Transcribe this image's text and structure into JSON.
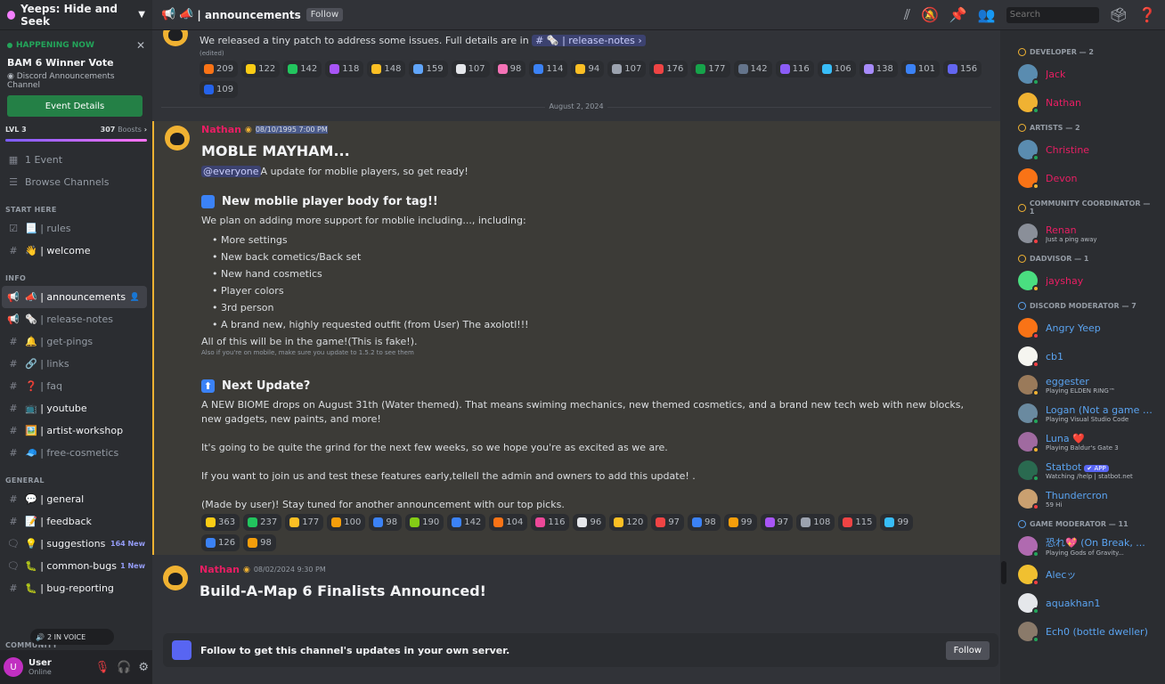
{
  "server": {
    "name": "Yeeps: Hide and Seek"
  },
  "event": {
    "happening": "HAPPENING NOW",
    "title": "BAM 6 Winner Vote",
    "location": "Discord Announcements Channel",
    "button": "Event Details"
  },
  "boost": {
    "level": "LVL 3",
    "count": "307",
    "label": "Boosts"
  },
  "sidebar_top": [
    {
      "icon": "calendar-icon",
      "label": "1 Event"
    },
    {
      "icon": "browse-icon",
      "label": "Browse Channels"
    }
  ],
  "categories": [
    {
      "name": "START HERE",
      "channels": [
        {
          "prefix": "☑",
          "label": "📃 | rules",
          "active": false,
          "badge": ""
        },
        {
          "prefix": "#",
          "label": "👋 | welcome",
          "active": false,
          "badge": "",
          "bright": true
        }
      ]
    },
    {
      "name": "INFO",
      "channels": [
        {
          "prefix": "📢",
          "label": "📣 | announcements",
          "active": true,
          "badge": ""
        },
        {
          "prefix": "📢",
          "label": "🗞️ | release-notes",
          "active": false,
          "badge": ""
        },
        {
          "prefix": "#",
          "label": "🔔 | get-pings",
          "active": false,
          "badge": ""
        },
        {
          "prefix": "#",
          "label": "🔗 | links",
          "active": false,
          "badge": ""
        },
        {
          "prefix": "#",
          "label": "❓ | faq",
          "active": false,
          "badge": ""
        },
        {
          "prefix": "#",
          "label": "📺 | youtube",
          "active": false,
          "badge": "",
          "bright": true
        },
        {
          "prefix": "#",
          "label": "🖼️ | artist-workshop",
          "active": false,
          "badge": "",
          "bright": true
        },
        {
          "prefix": "#",
          "label": "🧢 | free-cosmetics",
          "active": false,
          "badge": ""
        }
      ]
    },
    {
      "name": "GENERAL",
      "channels": [
        {
          "prefix": "#",
          "label": "💬 | general",
          "active": false,
          "badge": "",
          "bright": true
        },
        {
          "prefix": "#",
          "label": "📝 | feedback",
          "active": false,
          "badge": "",
          "bright": true
        },
        {
          "prefix": "🗨",
          "label": "💡 | suggestions",
          "active": false,
          "badge": "164 New",
          "bright": true
        },
        {
          "prefix": "🗨",
          "label": "🐛 | common-bugs",
          "active": false,
          "badge": "1 New",
          "bright": true
        },
        {
          "prefix": "#",
          "label": "🐛 | bug-reporting",
          "active": false,
          "badge": "",
          "bright": true
        }
      ]
    }
  ],
  "voice": {
    "label": "2 IN VOICE"
  },
  "bottom_cat": "COMMUNITY",
  "user": {
    "name": "User",
    "status": "Online"
  },
  "topbar": {
    "channel": "announcements",
    "follow": "Follow",
    "search_placeholder": "Search"
  },
  "prev_message": {
    "text": "We released a tiny patch to address some issues. Full details are in",
    "channel_link": "# 🗞️ | release-notes ›",
    "edited": "(edited)",
    "reactions": [
      {
        "c": "#f97316",
        "n": "209"
      },
      {
        "c": "#facc15",
        "n": "122"
      },
      {
        "c": "#22c55e",
        "n": "142"
      },
      {
        "c": "#a855f7",
        "n": "118"
      },
      {
        "c": "#fbbf24",
        "n": "148"
      },
      {
        "c": "#60a5fa",
        "n": "159"
      },
      {
        "c": "#e5e7eb",
        "n": "107"
      },
      {
        "c": "#f472b6",
        "n": "98"
      },
      {
        "c": "#3b82f6",
        "n": "114"
      },
      {
        "c": "#fbbf24",
        "n": "94"
      },
      {
        "c": "#9ca3af",
        "n": "107"
      },
      {
        "c": "#ef4444",
        "n": "176"
      },
      {
        "c": "#16a34a",
        "n": "177"
      },
      {
        "c": "#64748b",
        "n": "142"
      },
      {
        "c": "#8b5cf6",
        "n": "116"
      },
      {
        "c": "#38bdf8",
        "n": "106"
      },
      {
        "c": "#a78bfa",
        "n": "138"
      },
      {
        "c": "#3b82f6",
        "n": "101"
      },
      {
        "c": "#6366f1",
        "n": "156"
      },
      {
        "c": "#2563eb",
        "n": "109"
      }
    ]
  },
  "date_divider": "August 2, 2024",
  "message": {
    "author": "Nathan",
    "timestamp": "08/10/1995 7:00 PM",
    "title": "MOBLE MAYHAM...",
    "mention": "@everyone",
    "intro": "A update for moblie players, so get ready!",
    "section1_title": "New moblie player body for tag!!",
    "section1_text": "We plan on adding more support for moblie including..., including:",
    "list": [
      "More settings",
      "New back cometics/Back set",
      "New hand cosmetics",
      "Player colors",
      "3rd person",
      "A brand new, highly requested outfit (from User) The axolotl!!!"
    ],
    "after_list": "All of this will be in the game!(This is fake!).",
    "small_note": "Also if you're on mobile, make sure you update to 1.5.2 to see them",
    "section2_title": "Next Update?",
    "para1": "A NEW BIOME drops on August 31th (Water themed). That means swiming mechanics, new themed cosmetics, and a brand new tech web with new blocks, new gadgets, new paints, and more!",
    "para2": "It's going to be quite the grind for the next few weeks, so we hope you're as excited as we are.",
    "para3": "If you want to join us and test these features early,tellell the admin and owners to add this update! .",
    "para4": "(Made by user)! Stay tuned for another announcement with our top picks.",
    "reactions": [
      {
        "c": "#facc15",
        "n": "363"
      },
      {
        "c": "#22c55e",
        "n": "237"
      },
      {
        "c": "#fbbf24",
        "n": "177"
      },
      {
        "c": "#f59e0b",
        "n": "100"
      },
      {
        "c": "#3b82f6",
        "n": "98"
      },
      {
        "c": "#84cc16",
        "n": "190"
      },
      {
        "c": "#3b82f6",
        "n": "142"
      },
      {
        "c": "#f97316",
        "n": "104"
      },
      {
        "c": "#ec4899",
        "n": "116"
      },
      {
        "c": "#e5e7eb",
        "n": "96"
      },
      {
        "c": "#fbbf24",
        "n": "120"
      },
      {
        "c": "#ef4444",
        "n": "97"
      },
      {
        "c": "#3b82f6",
        "n": "98"
      },
      {
        "c": "#f59e0b",
        "n": "99"
      },
      {
        "c": "#a855f7",
        "n": "97"
      },
      {
        "c": "#9ca3af",
        "n": "108"
      },
      {
        "c": "#ef4444",
        "n": "115"
      },
      {
        "c": "#38bdf8",
        "n": "99"
      },
      {
        "c": "#3b82f6",
        "n": "126"
      },
      {
        "c": "#f59e0b",
        "n": "98"
      }
    ]
  },
  "next_message": {
    "author": "Nathan",
    "timestamp": "08/02/2024 9:30 PM",
    "title": "Build-A-Map 6 Finalists Announced!"
  },
  "follow_bar": {
    "text": "Follow to get this channel's updates in your own server.",
    "button": "Follow"
  },
  "member_groups": [
    {
      "name": "DEVELOPER — 2",
      "members": [
        {
          "name": "Jack",
          "color": "#e91e63",
          "av": "#5a8cb0",
          "st": "#23a55a",
          "activity": ""
        },
        {
          "name": "Nathan",
          "color": "#e91e63",
          "av": "#f0b232",
          "st": "#23a55a",
          "activity": ""
        }
      ]
    },
    {
      "name": "ARTISTS — 2",
      "members": [
        {
          "name": "Christine",
          "color": "#e91e63",
          "av": "#5a8cb0",
          "st": "#23a55a",
          "activity": ""
        },
        {
          "name": "Devon",
          "color": "#e91e63",
          "av": "#f97316",
          "st": "#f0b232",
          "activity": ""
        }
      ]
    },
    {
      "name": "COMMUNITY COORDINATOR — 1",
      "members": [
        {
          "name": "Renan",
          "color": "#e91e63",
          "av": "#8a8f99",
          "st": "#f23f43",
          "activity": "Just a ping away"
        }
      ]
    },
    {
      "name": "DADVISOR — 1",
      "members": [
        {
          "name": "jayshay",
          "color": "#e91e63",
          "av": "#4ade80",
          "st": "#f0b232",
          "activity": ""
        }
      ]
    },
    {
      "name": "DISCORD MODERATOR — 7",
      "members": [
        {
          "name": "Angry Yeep",
          "color": "#5aa3f0",
          "av": "#f97316",
          "st": "#f23f43",
          "activity": ""
        },
        {
          "name": "cb1",
          "color": "#5aa3f0",
          "av": "#f5f5f0",
          "st": "#f23f43",
          "activity": ""
        },
        {
          "name": "eggester",
          "color": "#5aa3f0",
          "av": "#9a7a5a",
          "st": "#f0b232",
          "activity": "Playing ELDEN RING™"
        },
        {
          "name": "Logan (Not a game m...",
          "color": "#5aa3f0",
          "av": "#6a8aa0",
          "st": "#23a55a",
          "activity": "Playing Visual Studio Code"
        },
        {
          "name": "Luna ❤️",
          "color": "#5aa3f0",
          "av": "#a06aa0",
          "st": "#f0b232",
          "activity": "Playing Baldur's Gate 3"
        },
        {
          "name": "Statbot",
          "color": "#5aa3f0",
          "av": "#2a6a50",
          "st": "#23a55a",
          "activity": "Watching /help | statbot.net",
          "app": "✔ APP"
        },
        {
          "name": "Thundercron",
          "color": "#5aa3f0",
          "av": "#caa070",
          "st": "#f23f43",
          "activity": "59 Hi"
        }
      ]
    },
    {
      "name": "GAME MODERATOR — 11",
      "members": [
        {
          "name": "恐れ💖 (On Break, ...",
          "color": "#5aa3f0",
          "av": "#b06ab0",
          "st": "#23a55a",
          "activity": "Playing Gods of Gravity..."
        },
        {
          "name": "Alecッ",
          "color": "#5aa3f0",
          "av": "#f0c030",
          "st": "#f23f43",
          "activity": ""
        },
        {
          "name": "aquakhan1",
          "color": "#5aa3f0",
          "av": "#e5e7eb",
          "st": "#23a55a",
          "activity": ""
        },
        {
          "name": "Ech0 (bottle dweller)",
          "color": "#5aa3f0",
          "av": "#8a7a6a",
          "st": "#23a55a",
          "activity": ""
        }
      ]
    }
  ]
}
